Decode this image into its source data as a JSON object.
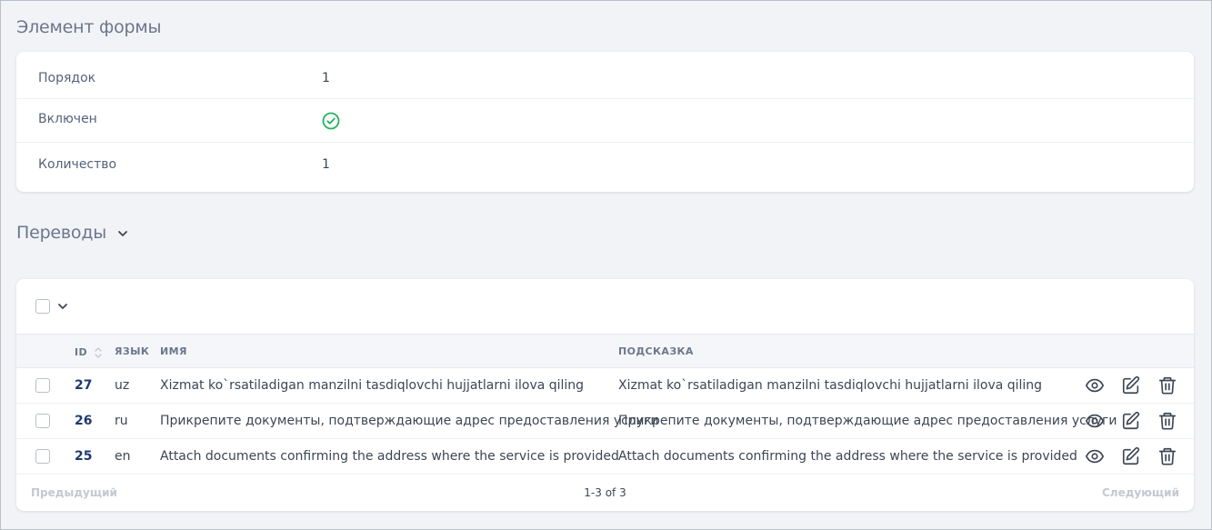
{
  "form_element": {
    "title": "Элемент формы",
    "fields": [
      {
        "label": "Порядок",
        "value": "1"
      },
      {
        "label": "Включен",
        "value": "",
        "icon": "check-circle-icon",
        "status_color": "#22b35e"
      },
      {
        "label": "Количество",
        "value": "1"
      }
    ]
  },
  "translations": {
    "title": "Переводы",
    "columns": {
      "id": "ID",
      "lang": "ЯЗЫК",
      "name": "ИМЯ",
      "hint": "ПОДСКАЗКА"
    },
    "rows": [
      {
        "id": "27",
        "lang": "uz",
        "name": "Xizmat ko`rsatiladigan manzilni tasdiqlovchi hujjatlarni ilova qiling",
        "hint": "Xizmat ko`rsatiladigan manzilni tasdiqlovchi hujjatlarni ilova qiling"
      },
      {
        "id": "26",
        "lang": "ru",
        "name": "Прикрепите документы, подтверждающие адрес предоставления услуги",
        "hint": "Прикрепите документы, подтверждающие адрес предоставления услуги"
      },
      {
        "id": "25",
        "lang": "en",
        "name": "Attach documents confirming the address where the service is provided",
        "hint": "Attach documents confirming the address where the service is provided"
      }
    ],
    "pagination": {
      "prev": "Предыдущий",
      "info": "1-3 of 3",
      "next": "Следующий"
    }
  },
  "colors": {
    "background": "#f2f3f7",
    "accent": "#1e3a6e",
    "success": "#22b35e",
    "icon": "#3c4655"
  }
}
